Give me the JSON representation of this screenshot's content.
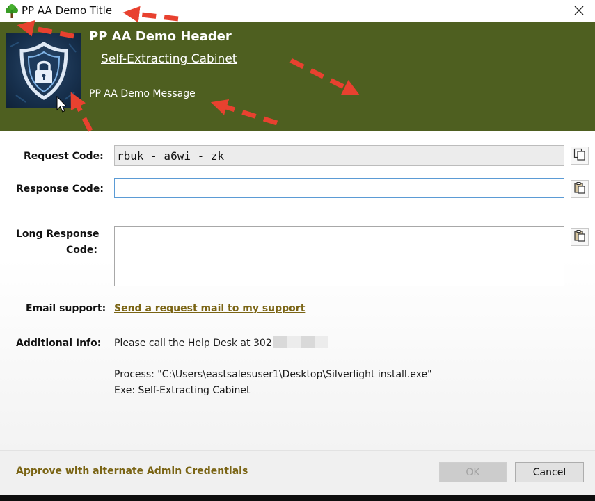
{
  "window": {
    "title": "PP AA Demo Title",
    "icon": "tree-icon",
    "close_icon": "close-icon"
  },
  "header": {
    "title": "PP AA Demo Header",
    "link": "Self-Extracting Cabinet",
    "message": "PP AA Demo Message",
    "logo_icon": "shield-lock-icon",
    "background_color": "#4e5f20"
  },
  "form": {
    "request_code": {
      "label": "Request Code:",
      "value": "rbuk - a6wi - zk"
    },
    "response_code": {
      "label": "Response Code:",
      "value": ""
    },
    "long_response_code": {
      "label_line1": "Long Response",
      "label_line2": "Code:",
      "value": ""
    },
    "email_support": {
      "label": "Email support:",
      "link": "Send a  request mail to my support"
    },
    "additional_info": {
      "label": "Additional Info:",
      "line1": "Please call the Help Desk at 302",
      "process": "Process: \"C:\\Users\\eastsalesuser1\\Desktop\\Silverlight install.exe\"",
      "exe": "Exe: Self-Extracting Cabinet"
    }
  },
  "footer": {
    "alt_link": "Approve with alternate Admin Credentials",
    "ok_label": "OK",
    "cancel_label": "Cancel"
  },
  "annotation_color": "#e8412f"
}
